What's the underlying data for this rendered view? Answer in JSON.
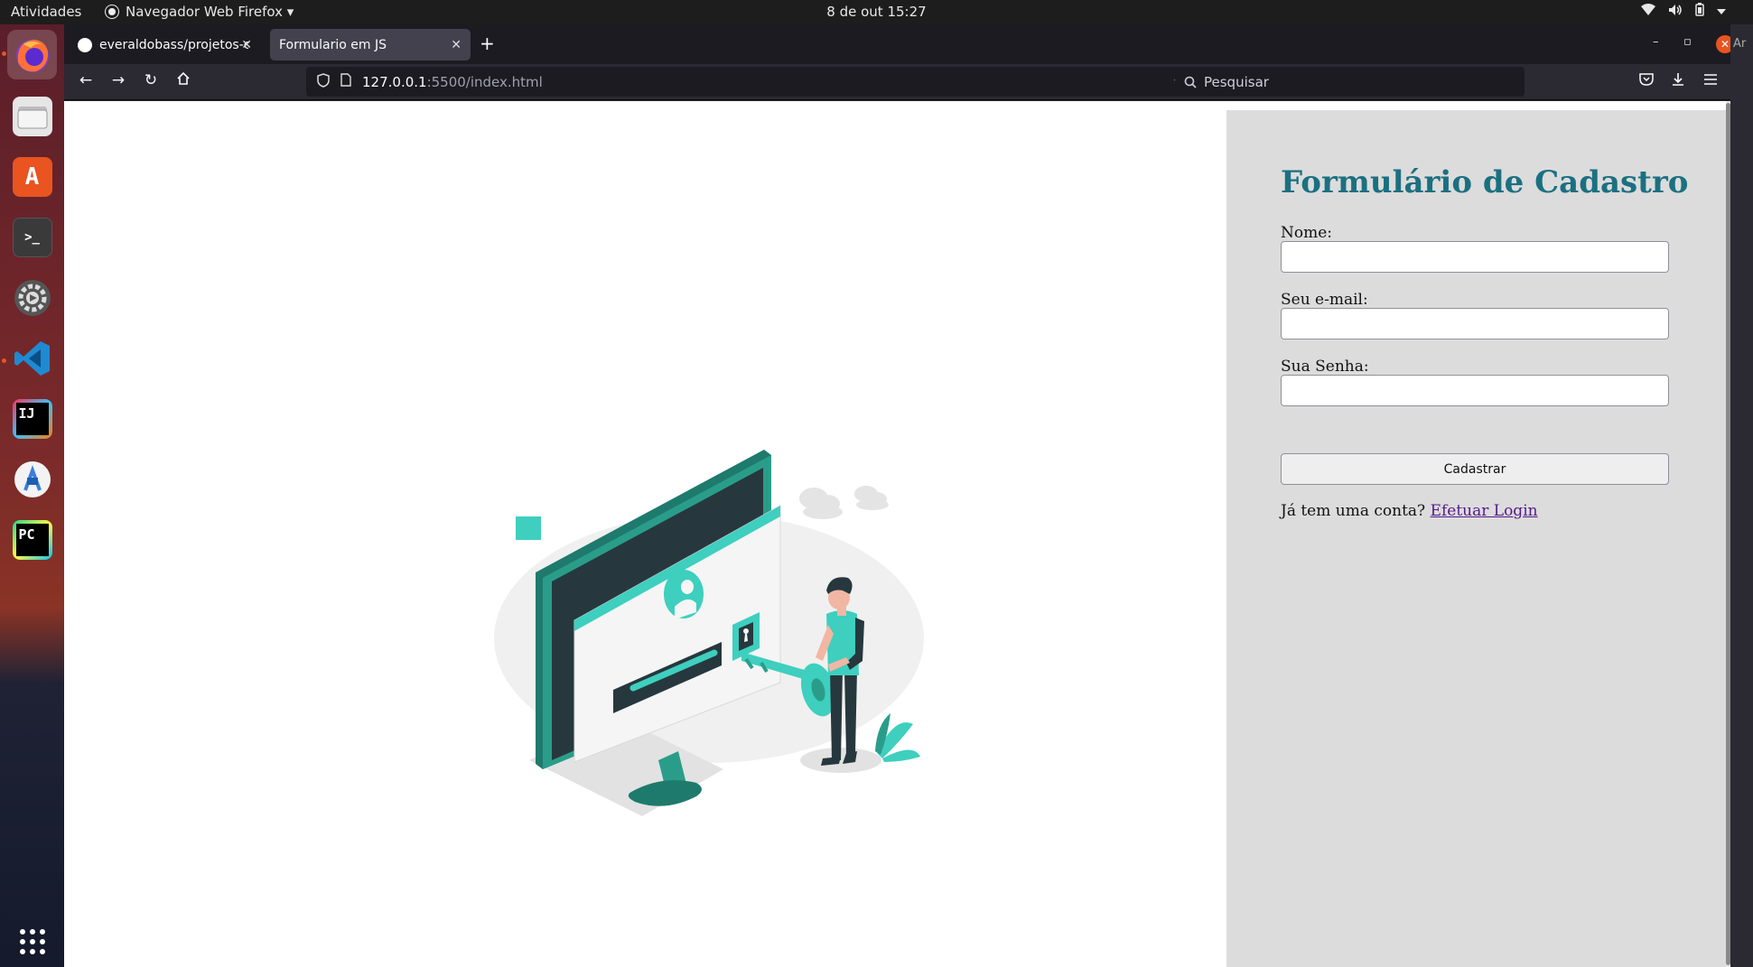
{
  "topbar": {
    "activities": "Atividades",
    "app_name": "Navegador Web Firefox ▾",
    "clock": "8 de out  15:27"
  },
  "browser": {
    "tabs": [
      {
        "label": "everaldobass/projetos-co",
        "selected": false
      },
      {
        "label": "Formulario em JS",
        "selected": true
      }
    ],
    "url": {
      "host": "127.0.0.1",
      "path": ":5500/index.html"
    },
    "search_placeholder": "Pesquisar"
  },
  "form": {
    "title": "Formulário de Cadastro",
    "fields": [
      {
        "label": "Nome:",
        "value": ""
      },
      {
        "label": "Seu e-mail:",
        "value": ""
      },
      {
        "label": "Sua Senha:",
        "value": ""
      }
    ],
    "submit_label": "Cadastrar",
    "login_prompt": "Já tem uma conta?",
    "login_link": "Efetuar Login"
  },
  "sidestrip_text": "Ar",
  "colors": {
    "title": "#1b7080",
    "accent_teal": "#3ecfbf",
    "panel_bg": "#dcdcdc",
    "link_visited": "#551a8b"
  }
}
